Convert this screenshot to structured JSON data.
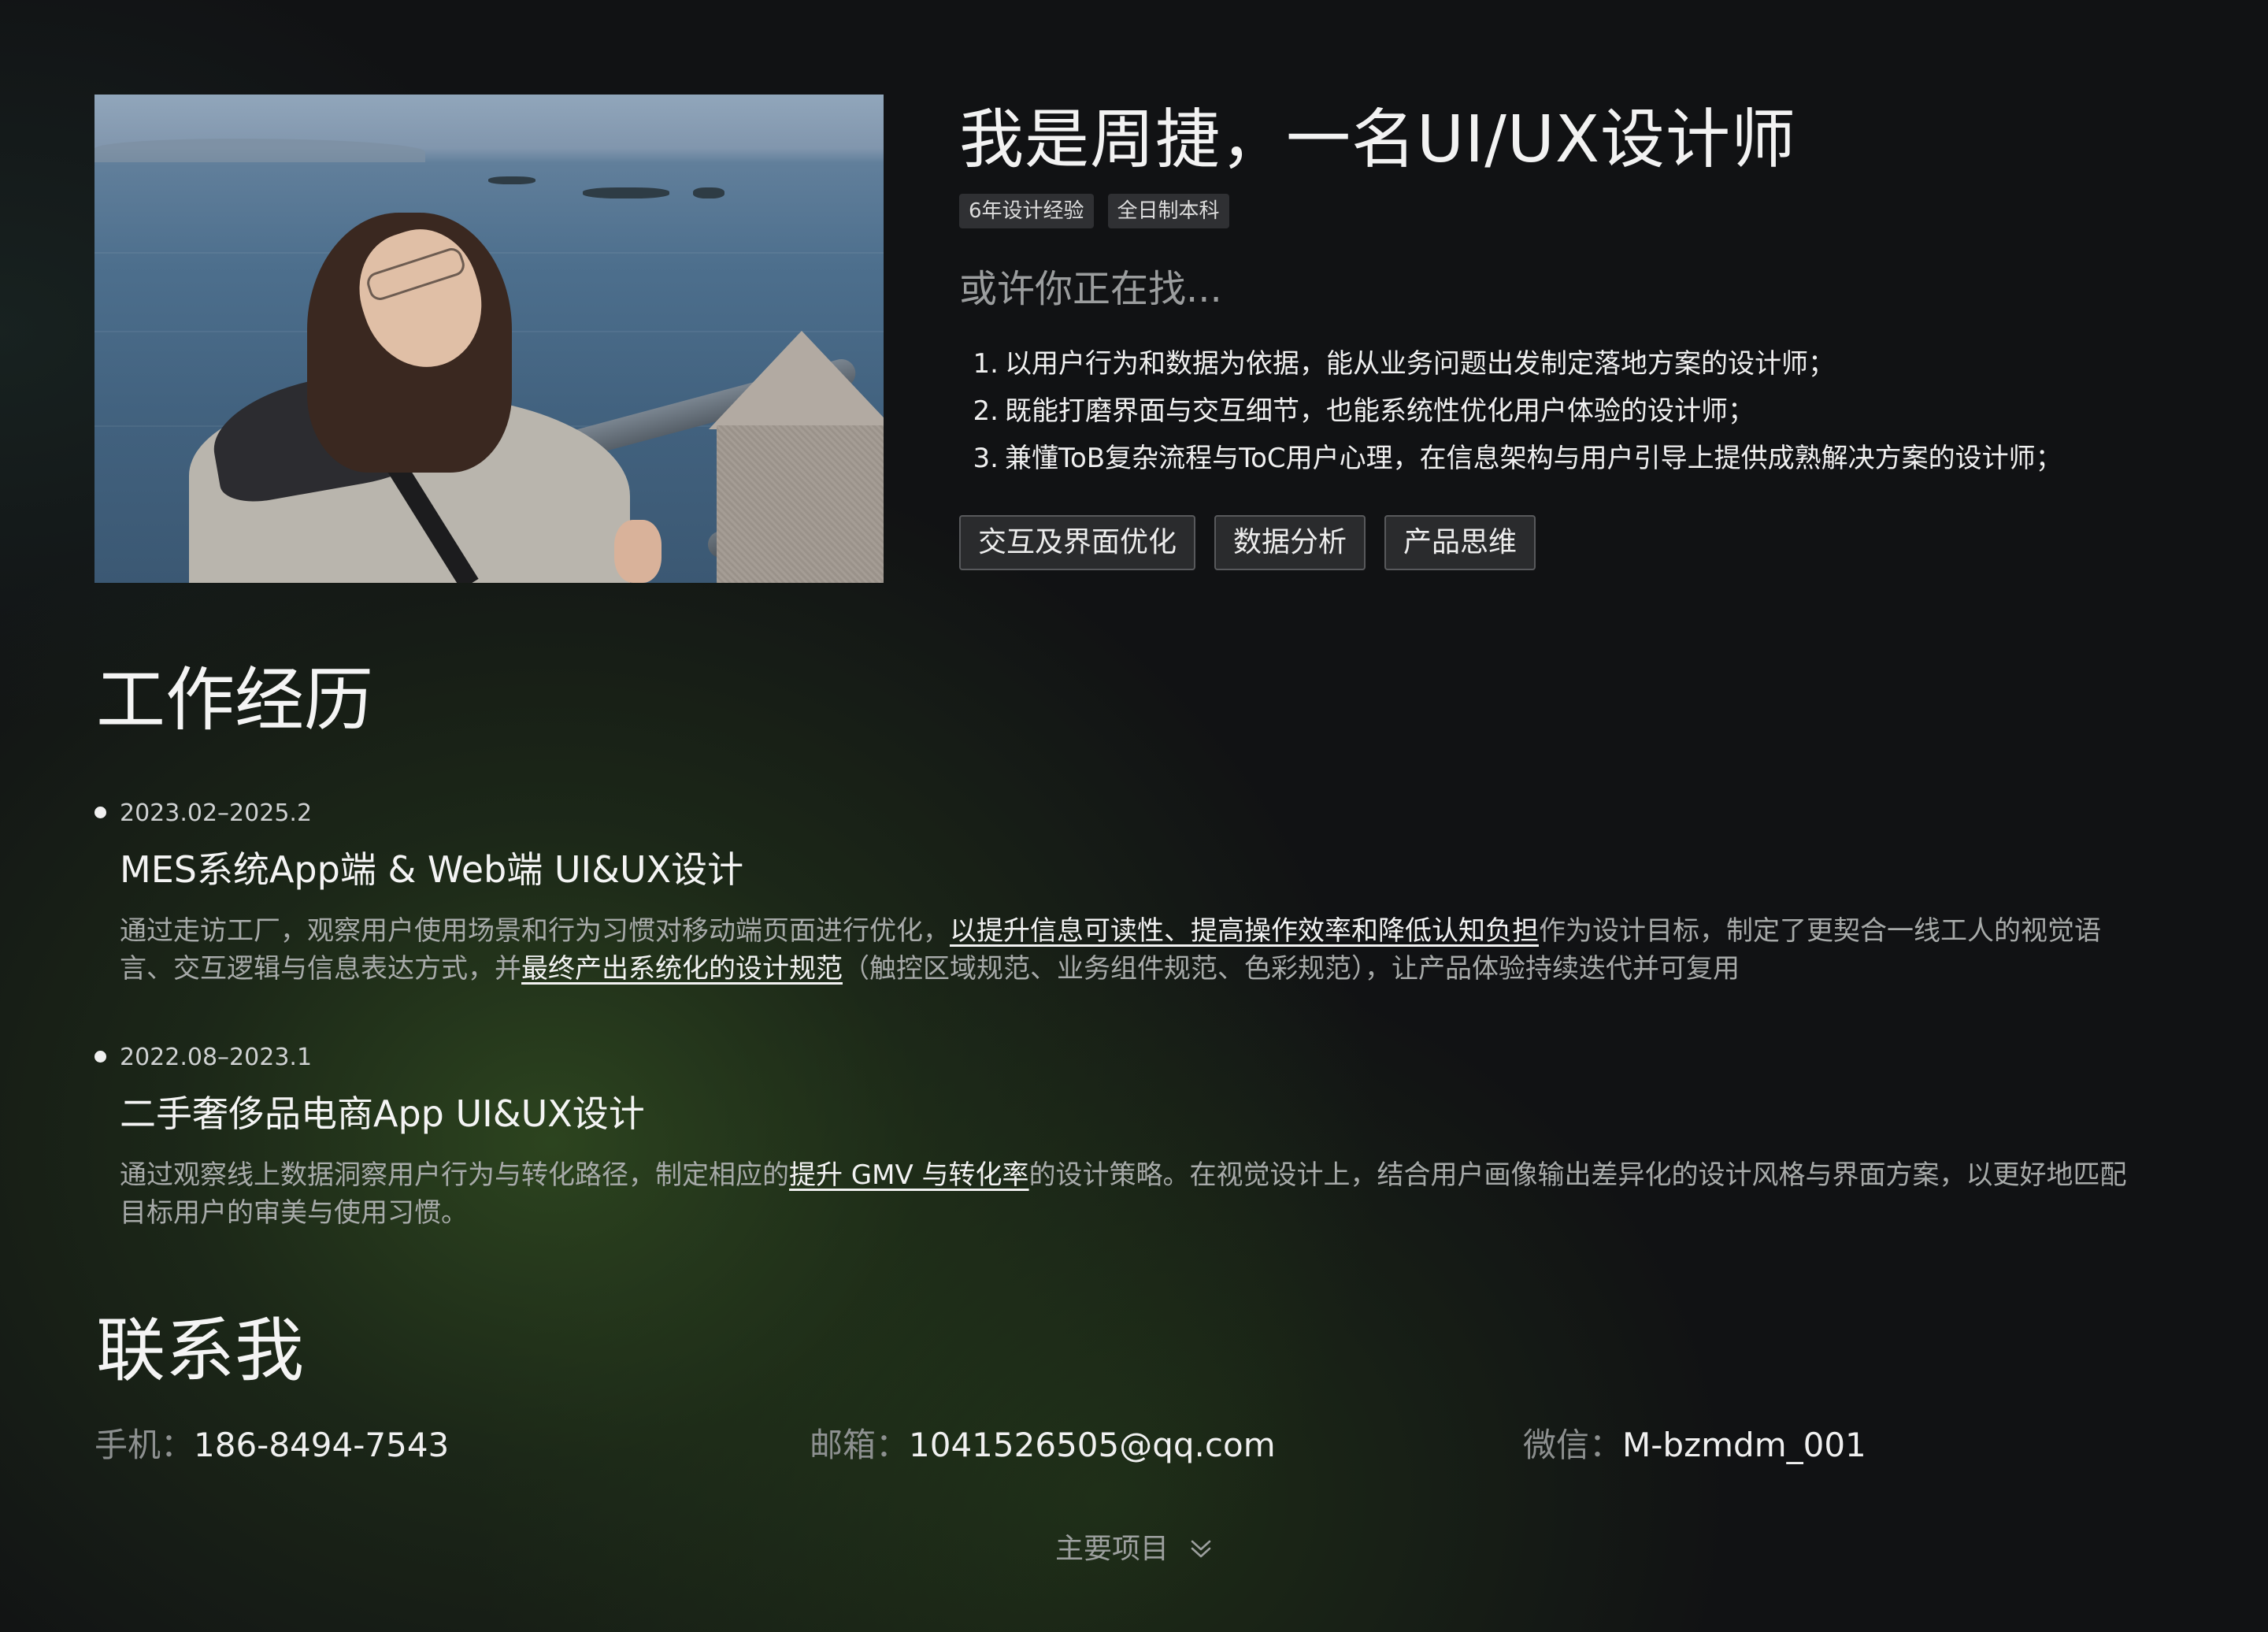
{
  "intro": {
    "headline": "我是周捷，一名UI/UX设计师",
    "tags": [
      "6年设计经验",
      "全日制本科"
    ],
    "subtitle": "或许你正在找...",
    "needs": [
      {
        "num": "1.",
        "text": "以用户行为和数据为依据，能从业务问题出发制定落地方案的设计师；"
      },
      {
        "num": "2.",
        "text": "既能打磨界面与交互细节，也能系统性优化用户体验的设计师；"
      },
      {
        "num": "3.",
        "text": "兼懂ToB复杂流程与ToC用户心理，在信息架构与用户引导上提供成熟解决方案的设计师；"
      }
    ],
    "skills": [
      "交互及界面优化",
      "数据分析",
      "产品思维"
    ]
  },
  "experience": {
    "heading": "工作经历",
    "jobs": [
      {
        "period": "2023.02–2025.2",
        "title": "MES系统App端 & Web端 UI&UX设计",
        "desc": {
          "p1": "通过走访工厂，观察用户使用场景和行为习惯对移动端页面进行优化，",
          "h1": "以提升信息可读性、提高操作效率和降低认知负担",
          "p2": "作为设计目标，制定了更契合一线工人的视觉语言、交互逻辑与信息表达方式，并",
          "h2": "最终产出系统化的设计规范",
          "p3": "（触控区域规范、业务组件规范、色彩规范），让产品体验持续迭代并可复用"
        }
      },
      {
        "period": "2022.08–2023.1",
        "title": "二手奢侈品电商App UI&UX设计",
        "desc": {
          "p1": "通过观察线上数据洞察用户行为与转化路径，制定相应的",
          "h1": "提升 GMV 与转化率",
          "p2": "的设计策略。在视觉设计上，结合用户画像输出差异化的设计风格与界面方案，以更好地匹配目标用户的审美与使用习惯。"
        }
      }
    ]
  },
  "contact": {
    "heading": "联系我",
    "phone_label": "手机：",
    "phone": "186-8494-7543",
    "email_label": "邮箱：",
    "email": "1041526505@qq.com",
    "wechat_label": "微信：",
    "wechat": "M-bzmdm_001"
  },
  "scroll_hint": {
    "label": "主要项目",
    "icon": "double-chevron-down-icon"
  },
  "colors": {
    "background": "#111214",
    "glow": "#2f4a22",
    "text": "#f0f0f0",
    "muted": "#9c9f9e"
  }
}
